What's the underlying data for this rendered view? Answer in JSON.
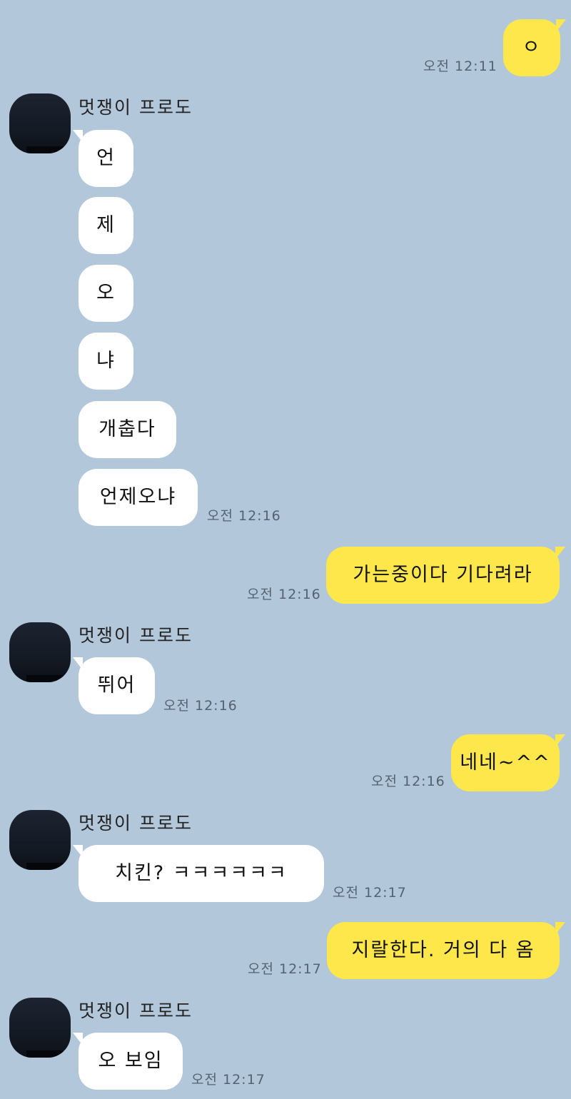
{
  "messages": [
    {
      "text": "ㅇ",
      "time": "오전 12:11"
    },
    {
      "sender": "멋쟁이 프로도"
    },
    {
      "text": "언"
    },
    {
      "text": "제"
    },
    {
      "text": "오"
    },
    {
      "text": "냐"
    },
    {
      "text": "개춥다"
    },
    {
      "text": "언제오냐",
      "time": "오전 12:16"
    },
    {
      "text": "가는중이다 기다려라",
      "time": "오전 12:16"
    },
    {
      "sender": "멋쟁이 프로도"
    },
    {
      "text": "뛰어",
      "time": "오전 12:16"
    },
    {
      "text": "네네~^^",
      "time": "오전 12:16"
    },
    {
      "sender": "멋쟁이 프로도"
    },
    {
      "text": "치킨? ㅋㅋㅋㅋㅋㅋ",
      "time": "오전 12:17"
    },
    {
      "text": "지랄한다. 거의 다 옴",
      "time": "오전 12:17"
    },
    {
      "sender": "멋쟁이 프로도"
    },
    {
      "text": "오 보임",
      "time": "오전 12:17"
    }
  ],
  "colors": {
    "background": "#b2c7da",
    "incoming_bubble": "#ffffff",
    "outgoing_bubble": "#fee74b"
  }
}
